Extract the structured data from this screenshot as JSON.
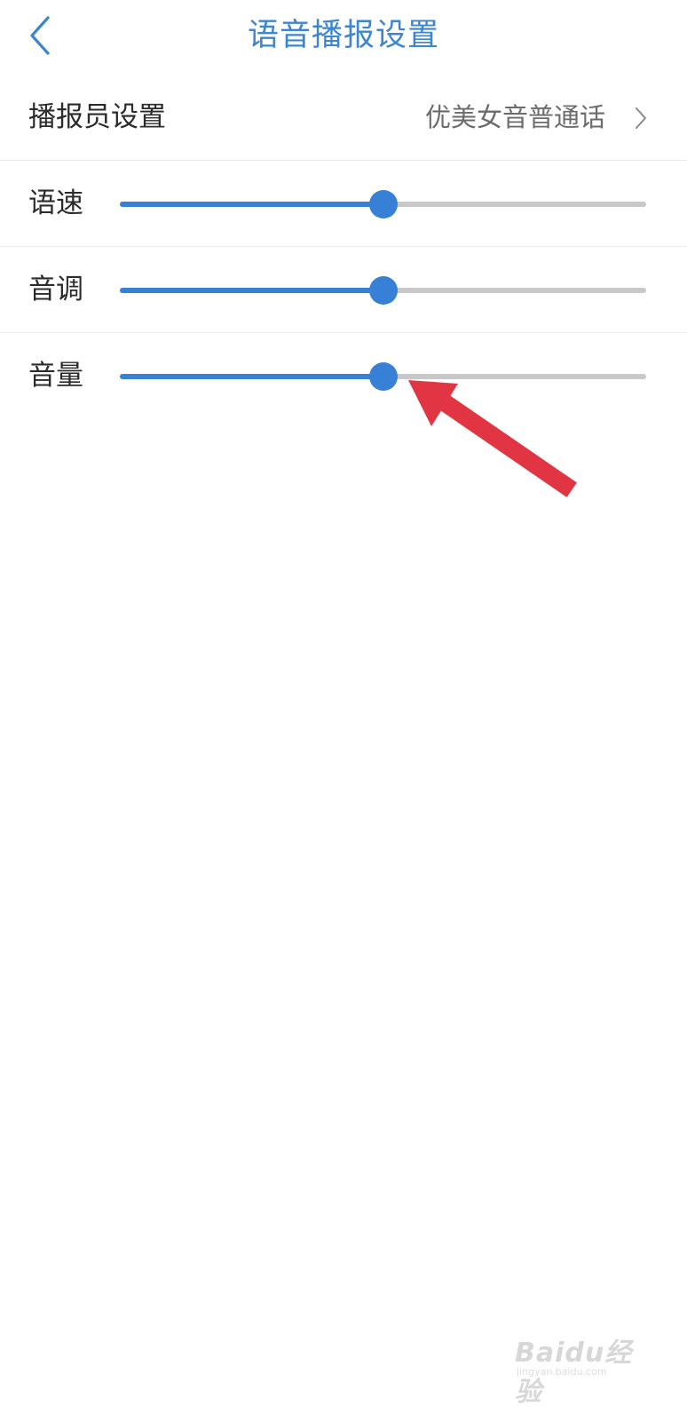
{
  "header": {
    "title": "语音播报设置",
    "back_icon": "chevron-left-icon"
  },
  "announcer": {
    "label": "播报员设置",
    "value": "优美女音普通话",
    "chevron_icon": "chevron-right-icon"
  },
  "sliders": [
    {
      "id": "speed",
      "label": "语速",
      "value_fraction": 0.5
    },
    {
      "id": "pitch",
      "label": "音调",
      "value_fraction": 0.5
    },
    {
      "id": "volume",
      "label": "音量",
      "value_fraction": 0.5
    }
  ],
  "colors": {
    "accent": "#3680d6",
    "title": "#3d85cf",
    "track": "#c8c8c8",
    "annotation_arrow": "#e23543"
  },
  "watermark": {
    "text": "Baidu经验",
    "sub": "jingyan.baidu.com"
  }
}
